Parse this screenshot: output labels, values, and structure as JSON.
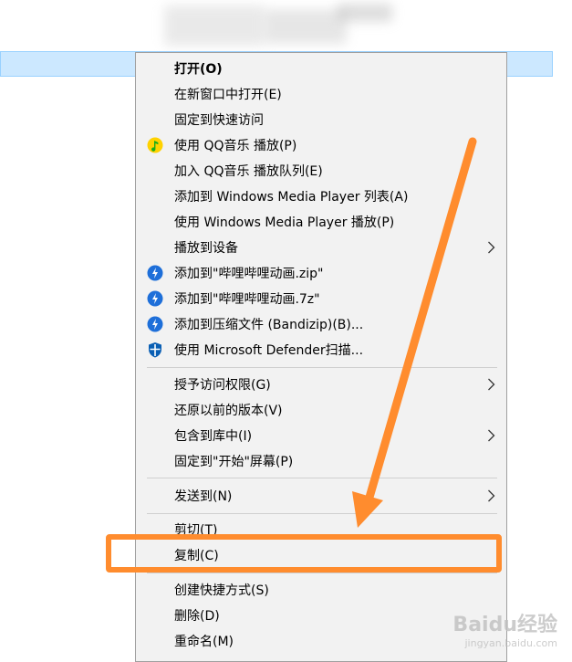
{
  "menu": {
    "items": [
      {
        "label": "打开(O)",
        "bold": true
      },
      {
        "label": "在新窗口中打开(E)"
      },
      {
        "label": "固定到快速访问"
      },
      {
        "label": "使用 QQ音乐 播放(P)",
        "icon": "qq-music-icon"
      },
      {
        "label": "加入 QQ音乐 播放队列(E)"
      },
      {
        "label": "添加到 Windows Media Player 列表(A)"
      },
      {
        "label": "使用 Windows Media Player 播放(P)"
      },
      {
        "label": "播放到设备",
        "submenu": true
      },
      {
        "label": "添加到\"哔哩哔哩动画.zip\"",
        "icon": "bandizip-icon"
      },
      {
        "label": "添加到\"哔哩哔哩动画.7z\"",
        "icon": "bandizip-icon"
      },
      {
        "label": "添加到压缩文件 (Bandizip)(B)...",
        "icon": "bandizip-icon"
      },
      {
        "label": "使用 Microsoft Defender扫描...",
        "icon": "defender-icon"
      },
      {
        "label": "授予访问权限(G)",
        "submenu": true
      },
      {
        "label": "还原以前的版本(V)"
      },
      {
        "label": "包含到库中(I)",
        "submenu": true
      },
      {
        "label": "固定到\"开始\"屏幕(P)"
      },
      {
        "label": "发送到(N)",
        "submenu": true
      },
      {
        "label": "剪切(T)"
      },
      {
        "label": "复制(C)"
      },
      {
        "label": "创建快捷方式(S)"
      },
      {
        "label": "删除(D)"
      },
      {
        "label": "重命名(M)"
      }
    ]
  },
  "colors": {
    "highlight": "#ff8c2e",
    "selection": "#cce8ff"
  },
  "watermark": {
    "brand": "Baidu经验",
    "sub": "jingyan.baidu.com"
  }
}
